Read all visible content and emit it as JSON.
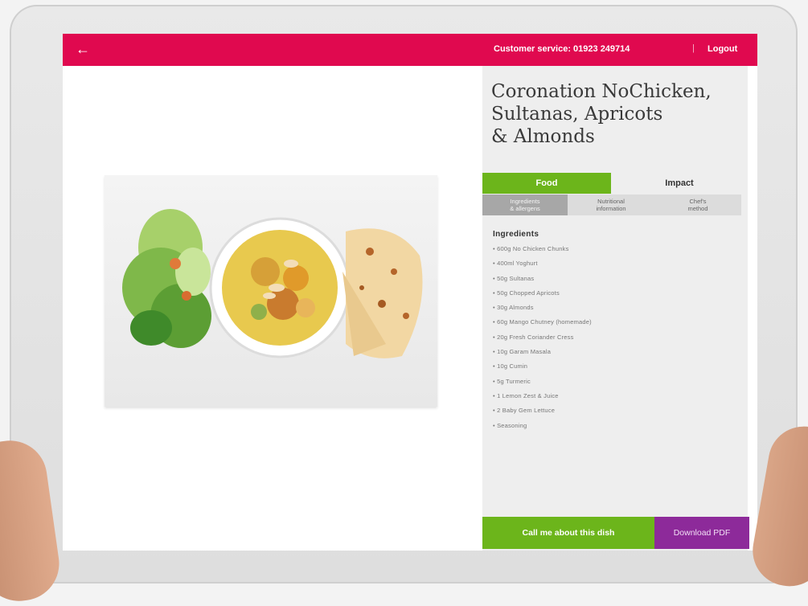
{
  "header": {
    "back_icon": "arrow-left-icon",
    "customer_service": "Customer service: 01923 249714",
    "separator": "|",
    "logout": "Logout"
  },
  "dish": {
    "title": "Coronation NoChicken,\nSultanas, Apricots\n& Almonds"
  },
  "tabs": [
    {
      "label": "Food",
      "active": true
    },
    {
      "label": "Impact",
      "active": false
    }
  ],
  "subtabs": [
    {
      "label": "Ingredients\n& allergens",
      "active": true
    },
    {
      "label": "Nutritional\ninformation",
      "active": false
    },
    {
      "label": "Chef's\nmethod",
      "active": false
    }
  ],
  "ingredients": {
    "heading": "Ingredients",
    "items": [
      "• 600g No Chicken Chunks",
      "• 400ml Yoghurt",
      "• 50g Sultanas",
      "• 50g Chopped Apricots",
      "• 30g Almonds",
      "• 60g Mango Chutney (homemade)",
      "• 20g Fresh Coriander Cress",
      "• 10g Garam Masala",
      "• 10g Cumin",
      "• 5g Turmeric",
      "• 1 Lemon Zest & Juice",
      "• 2 Baby Gem Lettuce",
      "• Seasoning"
    ]
  },
  "actions": {
    "call": "Call me about this dish",
    "pdf": "Download PDF"
  },
  "colors": {
    "header": "#e0094f",
    "food_tab": "#6cb51b",
    "call_button": "#6cb51b",
    "pdf_button": "#8d2a9a"
  }
}
